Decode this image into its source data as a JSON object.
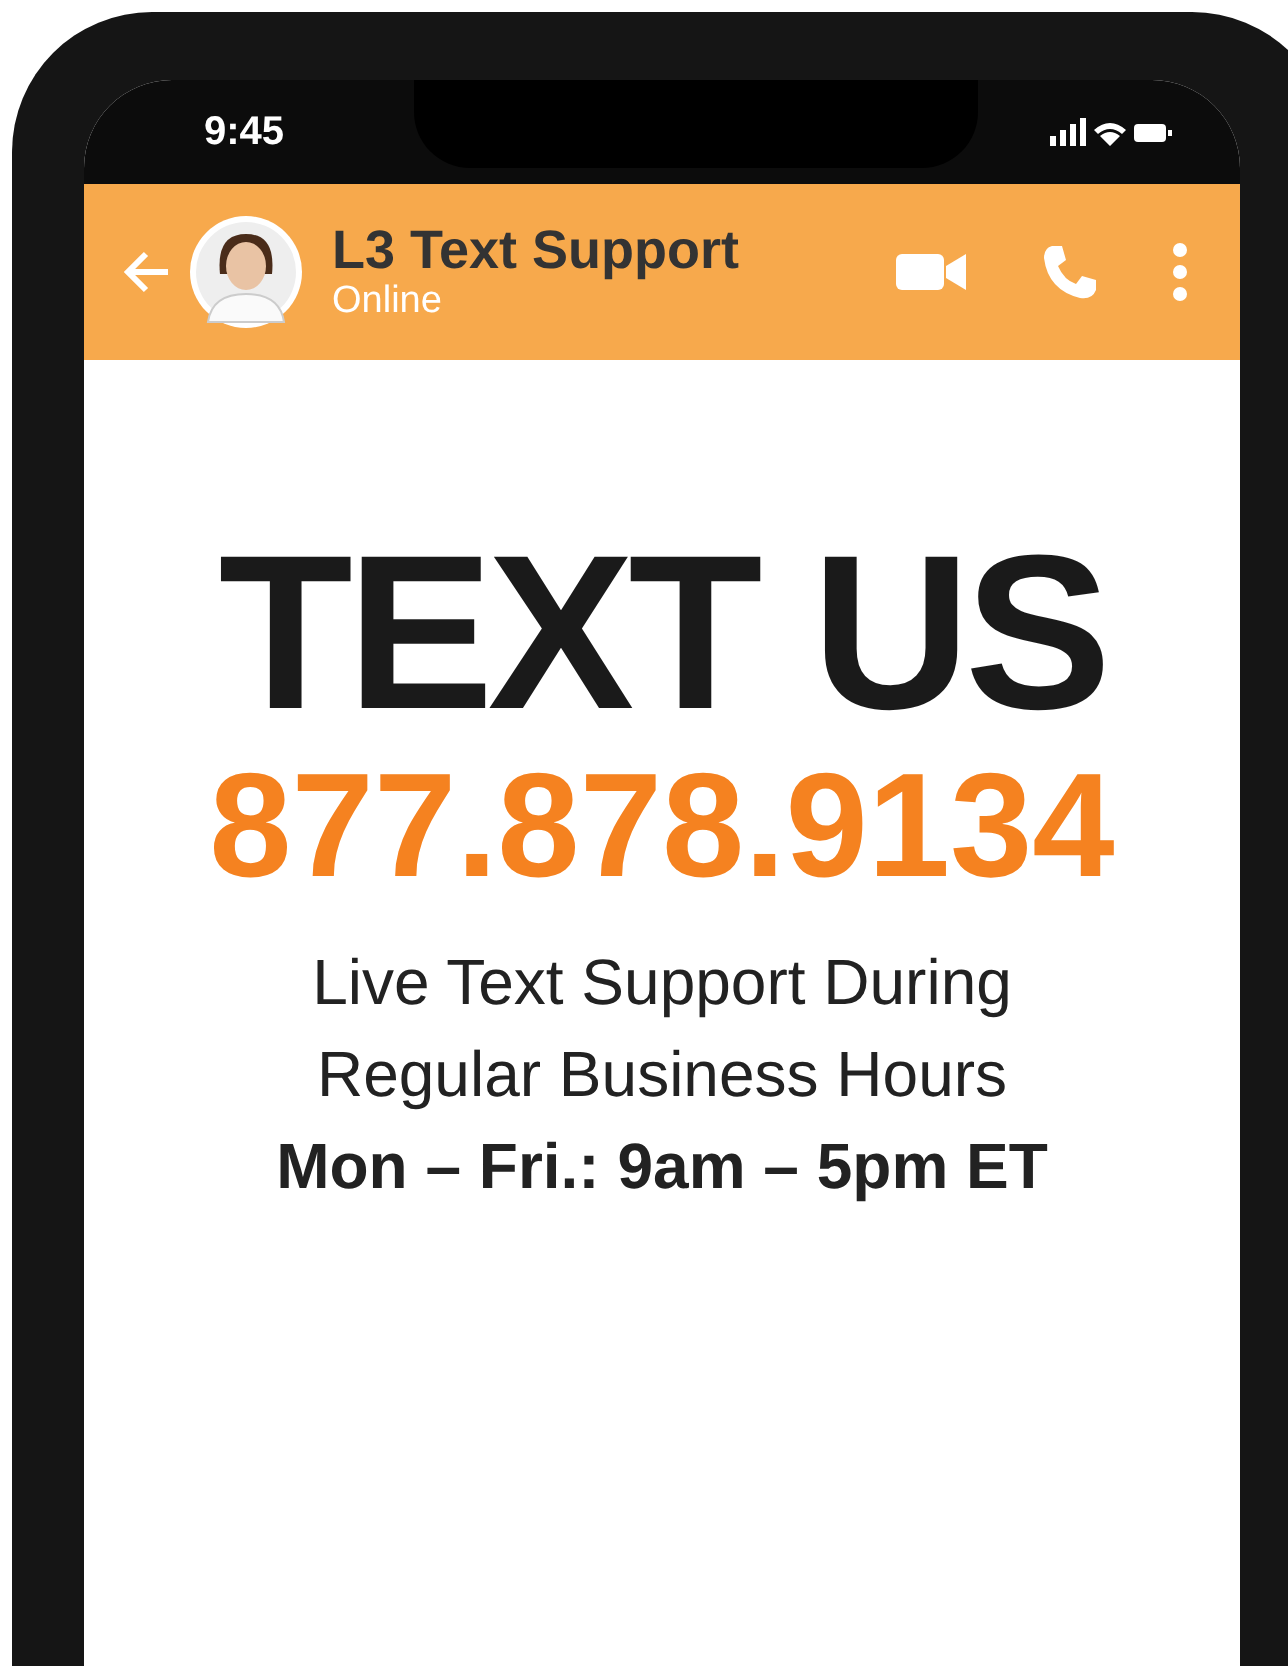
{
  "status_bar": {
    "time": "9:45"
  },
  "header": {
    "title": "L3 Text Support",
    "status": "Online"
  },
  "headline": "TEXT US",
  "phone_number": "877.878.9134",
  "hours": [
    {
      "text": "Live Text Support During",
      "kind": "normal"
    },
    {
      "text": "Regular Business Hours",
      "kind": "normal"
    },
    {
      "text": "Mon – Fri.: 9am – 5pm ET",
      "kind": "bold"
    }
  ]
}
